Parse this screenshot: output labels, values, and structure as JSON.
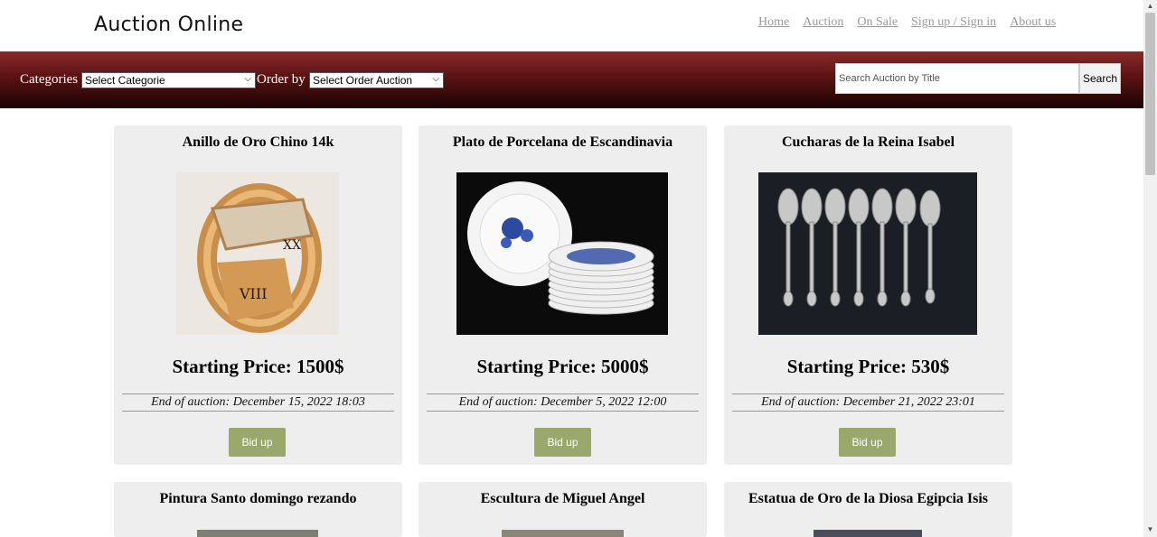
{
  "site": {
    "title": "Auction Online"
  },
  "nav": [
    "Home",
    "Auction",
    "On Sale",
    "Sign up / Sign in",
    "About us"
  ],
  "filters": {
    "categories_label": "Categories",
    "categories_value": "Select Categorie",
    "order_label": "Order by",
    "order_value": "Select Order Auction"
  },
  "search": {
    "placeholder": "Search Auction by Title",
    "button": "Search"
  },
  "cards": [
    {
      "title": "Anillo de Oro Chino 14k",
      "price": "Starting Price: 1500$",
      "end": "End of auction: December 15, 2022 18:03",
      "bid": "Bid up"
    },
    {
      "title": "Plato de Porcelana de Escandinavia",
      "price": "Starting Price: 5000$",
      "end": "End of auction: December 5, 2022 12:00",
      "bid": "Bid up"
    },
    {
      "title": "Cucharas de la Reina Isabel",
      "price": "Starting Price: 530$",
      "end": "End of auction: December 21, 2022 23:01",
      "bid": "Bid up"
    },
    {
      "title": "Pintura Santo domingo rezando"
    },
    {
      "title": "Escultura de Miguel Angel"
    },
    {
      "title": "Estatua de Oro de la Diosa Egipcia Isis"
    }
  ],
  "colors": {
    "band_dark": "#1a0404",
    "band_red": "#8a2a2a",
    "card_bg": "#eeeeee",
    "bid_button": "#9aa86b",
    "nav_link": "#9a9a9a"
  }
}
